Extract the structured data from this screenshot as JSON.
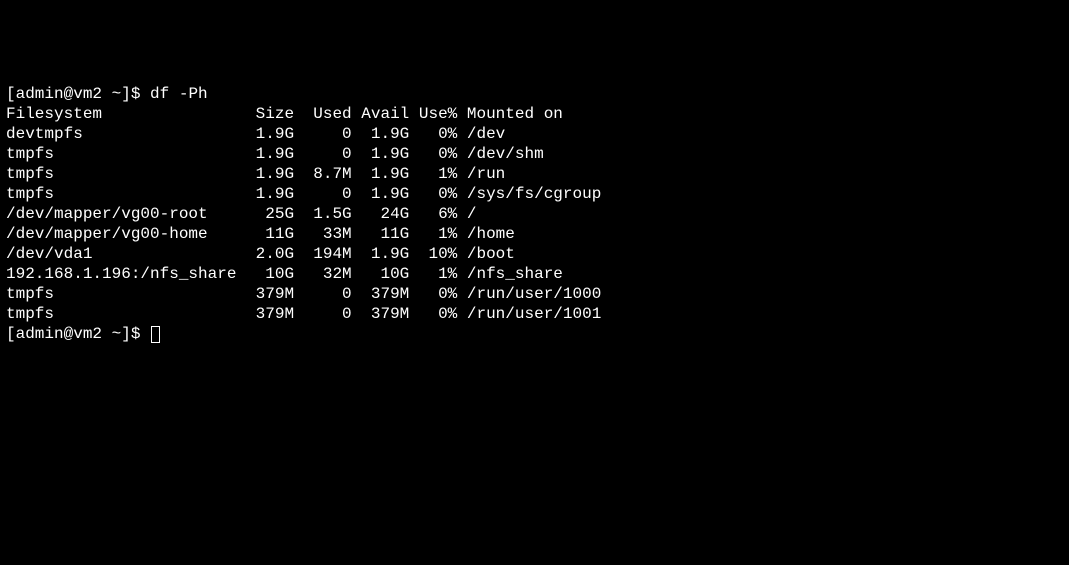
{
  "prompt1": "[admin@vm2 ~]$ ",
  "command": "df -Ph",
  "header": {
    "filesystem": "Filesystem",
    "size": "Size",
    "used": "Used",
    "avail": "Avail",
    "usepct": "Use%",
    "mounted": "Mounted on"
  },
  "rows": [
    {
      "filesystem": "devtmpfs",
      "size": "1.9G",
      "used": "0",
      "avail": "1.9G",
      "usepct": "0%",
      "mounted": "/dev"
    },
    {
      "filesystem": "tmpfs",
      "size": "1.9G",
      "used": "0",
      "avail": "1.9G",
      "usepct": "0%",
      "mounted": "/dev/shm"
    },
    {
      "filesystem": "tmpfs",
      "size": "1.9G",
      "used": "8.7M",
      "avail": "1.9G",
      "usepct": "1%",
      "mounted": "/run"
    },
    {
      "filesystem": "tmpfs",
      "size": "1.9G",
      "used": "0",
      "avail": "1.9G",
      "usepct": "0%",
      "mounted": "/sys/fs/cgroup"
    },
    {
      "filesystem": "/dev/mapper/vg00-root",
      "size": "25G",
      "used": "1.5G",
      "avail": "24G",
      "usepct": "6%",
      "mounted": "/"
    },
    {
      "filesystem": "/dev/mapper/vg00-home",
      "size": "11G",
      "used": "33M",
      "avail": "11G",
      "usepct": "1%",
      "mounted": "/home"
    },
    {
      "filesystem": "/dev/vda1",
      "size": "2.0G",
      "used": "194M",
      "avail": "1.9G",
      "usepct": "10%",
      "mounted": "/boot"
    },
    {
      "filesystem": "192.168.1.196:/nfs_share",
      "size": "10G",
      "used": "32M",
      "avail": "10G",
      "usepct": "1%",
      "mounted": "/nfs_share"
    },
    {
      "filesystem": "tmpfs",
      "size": "379M",
      "used": "0",
      "avail": "379M",
      "usepct": "0%",
      "mounted": "/run/user/1000"
    },
    {
      "filesystem": "tmpfs",
      "size": "379M",
      "used": "0",
      "avail": "379M",
      "usepct": "0%",
      "mounted": "/run/user/1001"
    }
  ],
  "prompt2": "[admin@vm2 ~]$ "
}
